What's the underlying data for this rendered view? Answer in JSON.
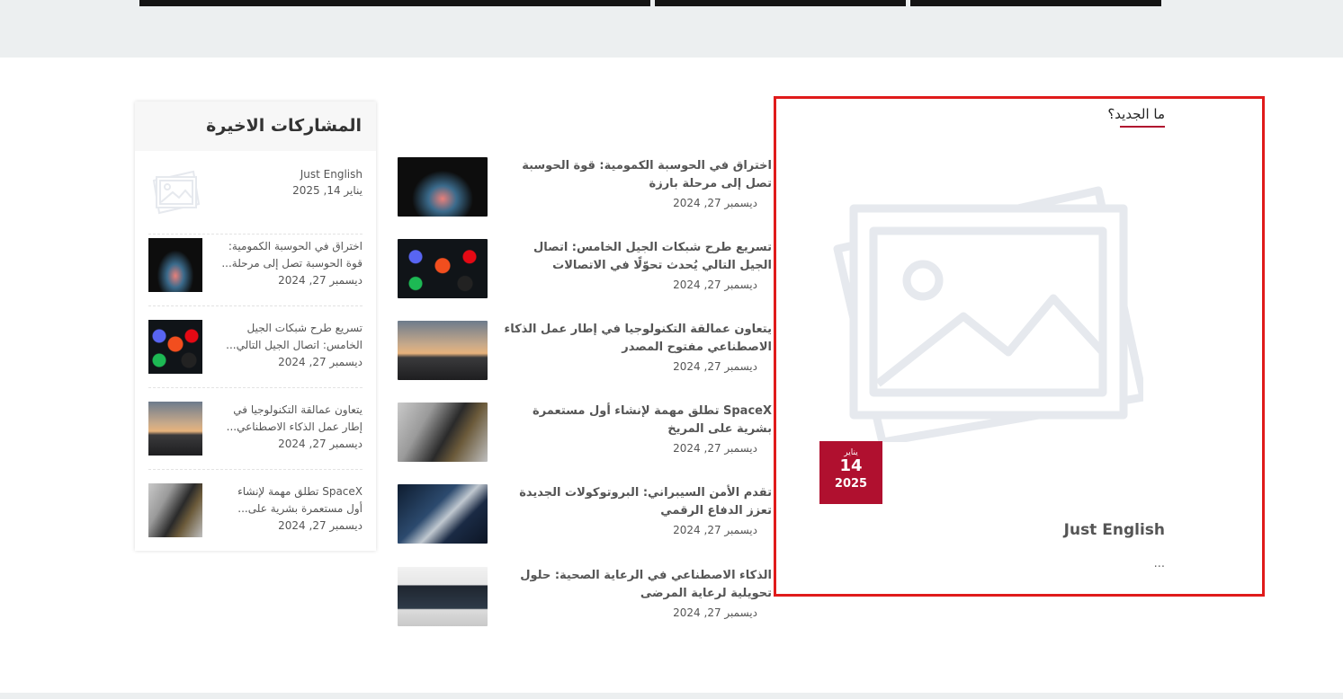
{
  "whats_new": {
    "title": "ما الجديد؟",
    "featured": {
      "date_month": "يناير",
      "date_day": "14",
      "date_year": "2025",
      "title": "Just English",
      "excerpt": "..."
    }
  },
  "middle_list": [
    {
      "title": "اختراق في الحوسبة الكمومية: قوة الحوسبة تصل إلى مرحلة بارزة",
      "date": "ديسمبر 27, 2024",
      "thumb": "laptop-glow-image"
    },
    {
      "title": "تسريع طرح شبكات الجيل الخامس: اتصال الجيل التالي يُحدث تحوّلًا في الاتصالات",
      "date": "ديسمبر 27, 2024",
      "thumb": "app-icons-image"
    },
    {
      "title": "يتعاون عمالقة التكنولوجيا في إطار عمل الذكاء الاصطناعي مفتوح المصدر",
      "date": "ديسمبر 27, 2024",
      "thumb": "sunset-person-image"
    },
    {
      "title": "SpaceX تطلق مهمة لإنشاء أول مستعمرة بشرية على المريخ",
      "date": "ديسمبر 27, 2024",
      "thumb": "car-interior-image"
    },
    {
      "title": "تقدم الأمن السيبراني: البروتوكولات الجديدة تعزز الدفاع الرقمي",
      "date": "ديسمبر 27, 2024",
      "thumb": "security-image"
    },
    {
      "title": "الذكاء الاصطناعي في الرعاية الصحية: حلول تحويلية لرعاية المرضى",
      "date": "ديسمبر 27, 2024",
      "thumb": "desk-laptop-image"
    }
  ],
  "recent_posts": {
    "title": "المشاركات الاخيرة",
    "items": [
      {
        "title": "Just English",
        "date": "يناير 14, 2025",
        "thumb": "placeholder-image"
      },
      {
        "title": "اختراق في الحوسبة الكمومية: قوة الحوسبة تصل إلى مرحلة...",
        "date": "ديسمبر 27, 2024",
        "thumb": "laptop-glow-image"
      },
      {
        "title": "تسريع طرح شبكات الجيل الخامس: اتصال الجيل التالي...",
        "date": "ديسمبر 27, 2024",
        "thumb": "app-icons-image"
      },
      {
        "title": "يتعاون عمالقة التكنولوجيا في إطار عمل الذكاء الاصطناعي...",
        "date": "ديسمبر 27, 2024",
        "thumb": "sunset-person-image"
      },
      {
        "title": "SpaceX تطلق مهمة لإنشاء أول مستعمرة بشرية على...",
        "date": "ديسمبر 27, 2024",
        "thumb": "car-interior-image"
      }
    ]
  },
  "colors": {
    "accent": "#b0102f",
    "highlight_border": "#e01b1b",
    "band": "#eceff0"
  }
}
